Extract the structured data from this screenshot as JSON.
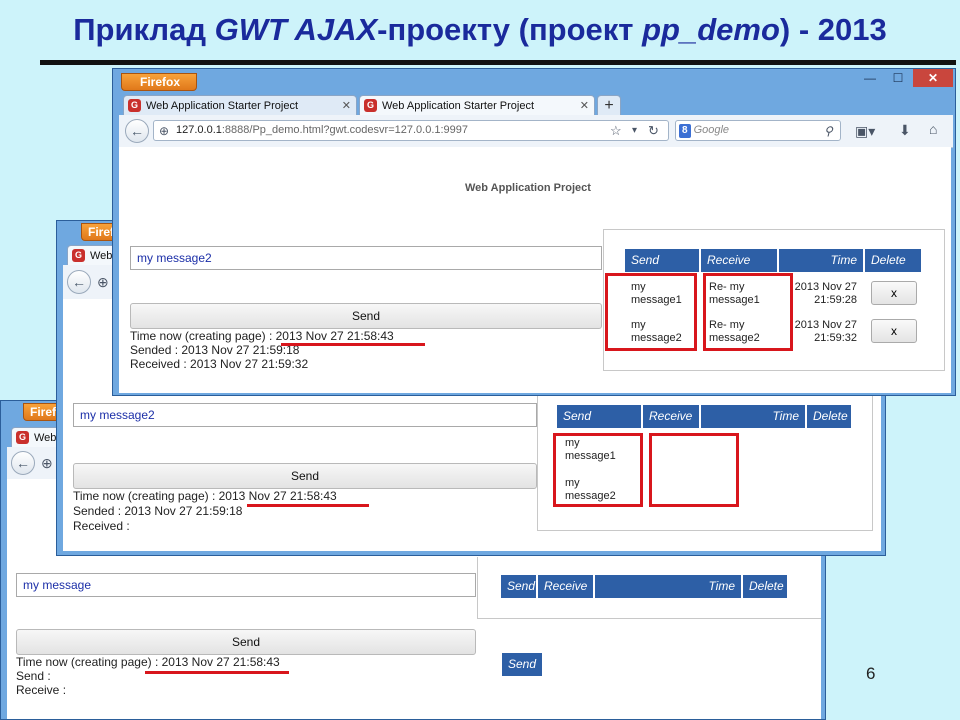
{
  "slide": {
    "title_part1": "Приклад ",
    "title_part2": "GWT AJAX",
    "title_part3": "-проекту (проект ",
    "title_part4": "pp_demo",
    "title_part5": ") - 2013",
    "page_number": "6"
  },
  "colors": {
    "accent": "#1a2a9c",
    "highlight": "#d8161c",
    "table_header": "#2d5fa6",
    "firefox_button": "#e0781a"
  },
  "browser": {
    "firefox_button_label": "Firefox",
    "firefox_button_label_short": "Firefo",
    "tab_title": "Web Application Starter Project",
    "tab_title_short": "Web",
    "url_host": "127.0.0.1",
    "url_path": ":8888/Pp_demo.html?gwt.codesvr=127.0.0.1:9997",
    "search_placeholder": "Google",
    "search_engine_badge": "8",
    "window_controls": [
      "—",
      "☐",
      "✕"
    ]
  },
  "screen3": {
    "app_title": "Web Application Project",
    "input_value": "my message2",
    "send_label": "Send",
    "time_now_label": "Time now (creating page) : ",
    "time_now_value": "2013 Nov 27 21:58:43",
    "sended_line": "Sended : 2013 Nov 27 21:59:18",
    "received_line": "Received : 2013 Nov 27 21:59:32",
    "table": {
      "headers": [
        "Send",
        "Receive",
        "Time",
        "Delete"
      ],
      "rows": [
        {
          "send": [
            "my",
            "message1"
          ],
          "receive": [
            "Re- my",
            "message1"
          ],
          "time": [
            "2013 Nov 27",
            "21:59:28"
          ],
          "delete": "x"
        },
        {
          "send": [
            "my",
            "message2"
          ],
          "receive": [
            "Re- my",
            "message2"
          ],
          "time": [
            "2013 Nov 27",
            "21:59:32"
          ],
          "delete": "x"
        }
      ]
    }
  },
  "screen2": {
    "input_value": "my message2",
    "send_label": "Send",
    "time_now_label": "Time now (creating page) : ",
    "time_now_value": "2013 Nov 27 21:58:43",
    "sended_line": "Sended : 2013 Nov 27 21:59:18",
    "received_line": "Received :",
    "table": {
      "headers": [
        "Send",
        "Receive",
        "Time",
        "Delete"
      ],
      "rows": [
        {
          "send": [
            "my",
            "message1"
          ]
        },
        {
          "send": [
            "my",
            "message2"
          ]
        }
      ]
    }
  },
  "screen1": {
    "input_value": "my message",
    "send_label": "Send",
    "time_now_label": "Time now (creating page) : ",
    "time_now_value": "2013 Nov 27 21:58:43",
    "send_line": "Send :",
    "receive_line": "Receive :",
    "table": {
      "headers": [
        "Send",
        "Receive",
        "Time",
        "Delete"
      ]
    }
  }
}
